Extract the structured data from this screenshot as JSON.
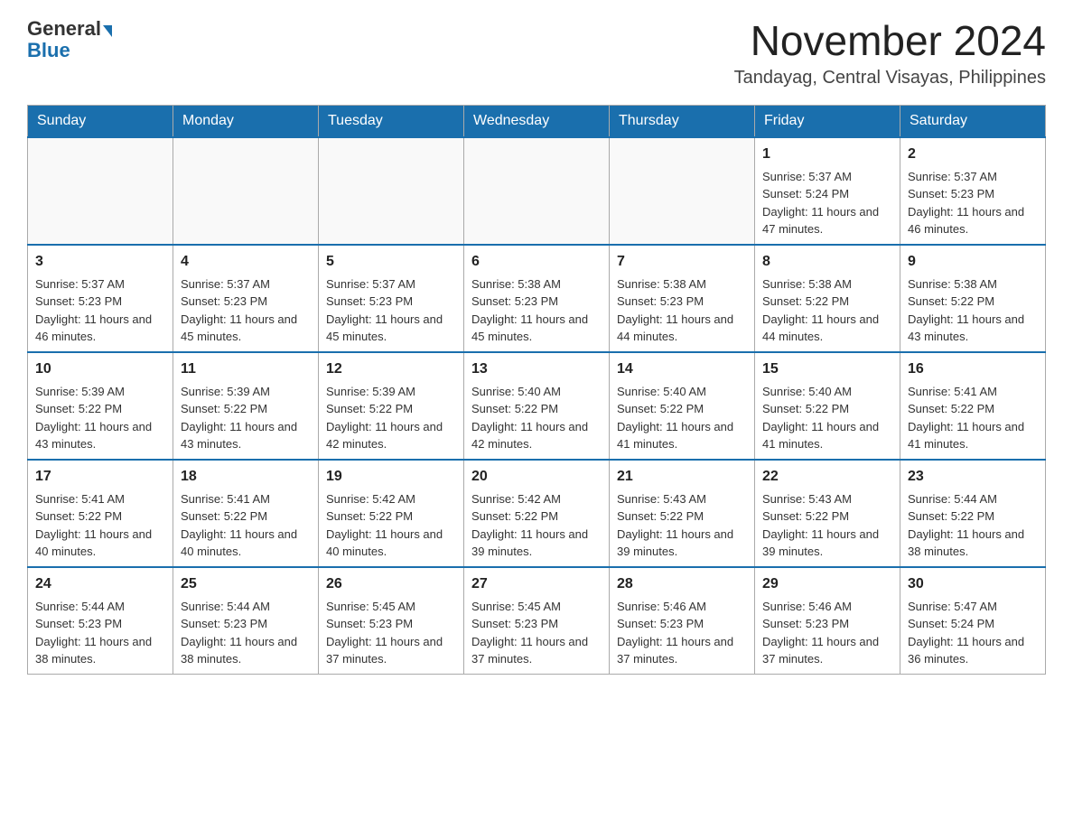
{
  "header": {
    "logo_general": "General",
    "logo_blue": "Blue",
    "month_title": "November 2024",
    "location": "Tandayag, Central Visayas, Philippines"
  },
  "days_of_week": [
    "Sunday",
    "Monday",
    "Tuesday",
    "Wednesday",
    "Thursday",
    "Friday",
    "Saturday"
  ],
  "weeks": [
    {
      "days": [
        {
          "day": "",
          "empty": true
        },
        {
          "day": "",
          "empty": true
        },
        {
          "day": "",
          "empty": true
        },
        {
          "day": "",
          "empty": true
        },
        {
          "day": "",
          "empty": true
        },
        {
          "day": "1",
          "sunrise": "5:37 AM",
          "sunset": "5:24 PM",
          "daylight": "11 hours and 47 minutes."
        },
        {
          "day": "2",
          "sunrise": "5:37 AM",
          "sunset": "5:23 PM",
          "daylight": "11 hours and 46 minutes."
        }
      ]
    },
    {
      "days": [
        {
          "day": "3",
          "sunrise": "5:37 AM",
          "sunset": "5:23 PM",
          "daylight": "11 hours and 46 minutes."
        },
        {
          "day": "4",
          "sunrise": "5:37 AM",
          "sunset": "5:23 PM",
          "daylight": "11 hours and 45 minutes."
        },
        {
          "day": "5",
          "sunrise": "5:37 AM",
          "sunset": "5:23 PM",
          "daylight": "11 hours and 45 minutes."
        },
        {
          "day": "6",
          "sunrise": "5:38 AM",
          "sunset": "5:23 PM",
          "daylight": "11 hours and 45 minutes."
        },
        {
          "day": "7",
          "sunrise": "5:38 AM",
          "sunset": "5:23 PM",
          "daylight": "11 hours and 44 minutes."
        },
        {
          "day": "8",
          "sunrise": "5:38 AM",
          "sunset": "5:22 PM",
          "daylight": "11 hours and 44 minutes."
        },
        {
          "day": "9",
          "sunrise": "5:38 AM",
          "sunset": "5:22 PM",
          "daylight": "11 hours and 43 minutes."
        }
      ]
    },
    {
      "days": [
        {
          "day": "10",
          "sunrise": "5:39 AM",
          "sunset": "5:22 PM",
          "daylight": "11 hours and 43 minutes."
        },
        {
          "day": "11",
          "sunrise": "5:39 AM",
          "sunset": "5:22 PM",
          "daylight": "11 hours and 43 minutes."
        },
        {
          "day": "12",
          "sunrise": "5:39 AM",
          "sunset": "5:22 PM",
          "daylight": "11 hours and 42 minutes."
        },
        {
          "day": "13",
          "sunrise": "5:40 AM",
          "sunset": "5:22 PM",
          "daylight": "11 hours and 42 minutes."
        },
        {
          "day": "14",
          "sunrise": "5:40 AM",
          "sunset": "5:22 PM",
          "daylight": "11 hours and 41 minutes."
        },
        {
          "day": "15",
          "sunrise": "5:40 AM",
          "sunset": "5:22 PM",
          "daylight": "11 hours and 41 minutes."
        },
        {
          "day": "16",
          "sunrise": "5:41 AM",
          "sunset": "5:22 PM",
          "daylight": "11 hours and 41 minutes."
        }
      ]
    },
    {
      "days": [
        {
          "day": "17",
          "sunrise": "5:41 AM",
          "sunset": "5:22 PM",
          "daylight": "11 hours and 40 minutes."
        },
        {
          "day": "18",
          "sunrise": "5:41 AM",
          "sunset": "5:22 PM",
          "daylight": "11 hours and 40 minutes."
        },
        {
          "day": "19",
          "sunrise": "5:42 AM",
          "sunset": "5:22 PM",
          "daylight": "11 hours and 40 minutes."
        },
        {
          "day": "20",
          "sunrise": "5:42 AM",
          "sunset": "5:22 PM",
          "daylight": "11 hours and 39 minutes."
        },
        {
          "day": "21",
          "sunrise": "5:43 AM",
          "sunset": "5:22 PM",
          "daylight": "11 hours and 39 minutes."
        },
        {
          "day": "22",
          "sunrise": "5:43 AM",
          "sunset": "5:22 PM",
          "daylight": "11 hours and 39 minutes."
        },
        {
          "day": "23",
          "sunrise": "5:44 AM",
          "sunset": "5:22 PM",
          "daylight": "11 hours and 38 minutes."
        }
      ]
    },
    {
      "days": [
        {
          "day": "24",
          "sunrise": "5:44 AM",
          "sunset": "5:23 PM",
          "daylight": "11 hours and 38 minutes."
        },
        {
          "day": "25",
          "sunrise": "5:44 AM",
          "sunset": "5:23 PM",
          "daylight": "11 hours and 38 minutes."
        },
        {
          "day": "26",
          "sunrise": "5:45 AM",
          "sunset": "5:23 PM",
          "daylight": "11 hours and 37 minutes."
        },
        {
          "day": "27",
          "sunrise": "5:45 AM",
          "sunset": "5:23 PM",
          "daylight": "11 hours and 37 minutes."
        },
        {
          "day": "28",
          "sunrise": "5:46 AM",
          "sunset": "5:23 PM",
          "daylight": "11 hours and 37 minutes."
        },
        {
          "day": "29",
          "sunrise": "5:46 AM",
          "sunset": "5:23 PM",
          "daylight": "11 hours and 37 minutes."
        },
        {
          "day": "30",
          "sunrise": "5:47 AM",
          "sunset": "5:24 PM",
          "daylight": "11 hours and 36 minutes."
        }
      ]
    }
  ]
}
